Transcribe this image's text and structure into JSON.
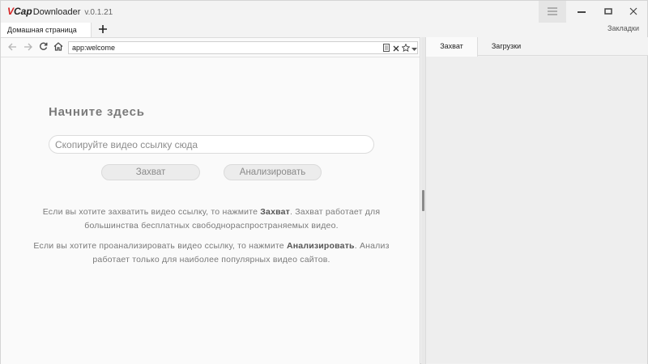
{
  "app": {
    "logo_v": "V",
    "logo_cap": "Cap",
    "logo_rest": "Downloader",
    "version": "v.0.1.21"
  },
  "window_controls": {
    "menu_icon": "hamburger-icon",
    "minimize_icon": "minimize-icon",
    "maximize_icon": "maximize-icon",
    "close_icon": "close-icon"
  },
  "tabs": [
    {
      "label": "Домашная страница"
    }
  ],
  "new_tab_icon": "plus-icon",
  "bookmarks_label": "Закладки",
  "nav": {
    "back_icon": "arrow-left-icon",
    "forward_icon": "arrow-right-icon",
    "reload_icon": "reload-icon",
    "home_icon": "home-icon",
    "url": "app:welcome",
    "reader_icon": "document-icon",
    "stop_icon": "close-icon",
    "star_icon": "star-icon",
    "dropdown_icon": "chevron-down-icon"
  },
  "main": {
    "heading": "Начните здесь",
    "input_placeholder": "Скопируйте видео ссылку сюда",
    "capture_button": "Захват",
    "analyze_button": "Анализировать",
    "info1": {
      "pre": "Если вы хотите захватить видео ссылку, то нажмите ",
      "bold": "Захват",
      "post": ". Захват работает для большинства бесплатных свободнораспространяемых видео."
    },
    "info2": {
      "pre": "Если вы хотите проанализировать видео ссылку, то нажмите ",
      "bold": "Анализировать",
      "post": ". Анализ работает только для наиболее популярных видео сайтов."
    }
  },
  "right_panel": {
    "tabs": [
      {
        "label": "Захват"
      },
      {
        "label": "Загрузки"
      }
    ]
  },
  "colors": {
    "logo_red": "#d62020",
    "background": "#f3f3f3",
    "content_background": "#fafafa"
  }
}
